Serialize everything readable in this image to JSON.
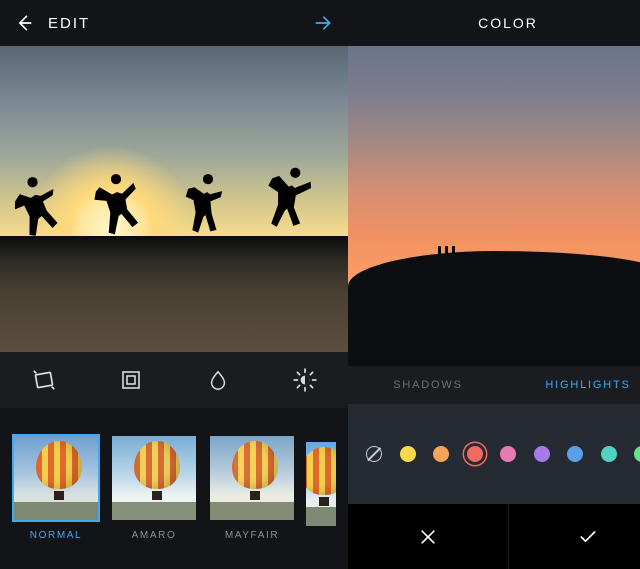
{
  "left": {
    "header_title": "EDIT",
    "tools": [
      {
        "name": "straighten",
        "label": "Straighten"
      },
      {
        "name": "frame",
        "label": "Frame"
      },
      {
        "name": "blur",
        "label": "Tilt Shift"
      },
      {
        "name": "lux",
        "label": "Lux"
      }
    ],
    "filters": [
      {
        "label": "NORMAL",
        "selected": true
      },
      {
        "label": "AMARO",
        "selected": false
      },
      {
        "label": "MAYFAIR",
        "selected": false
      },
      {
        "label": "",
        "selected": false
      }
    ]
  },
  "right": {
    "header_title": "COLOR",
    "tabs": [
      {
        "label": "SHADOWS",
        "active": false
      },
      {
        "label": "HIGHLIGHTS",
        "active": true
      }
    ],
    "swatches": [
      {
        "name": "none",
        "color": "none",
        "selected": false
      },
      {
        "name": "yellow",
        "color": "#f7d94c",
        "selected": false
      },
      {
        "name": "orange",
        "color": "#f4a35a",
        "selected": false
      },
      {
        "name": "red",
        "color": "#ef6a63",
        "selected": true
      },
      {
        "name": "pink",
        "color": "#e77bb4",
        "selected": false
      },
      {
        "name": "purple",
        "color": "#a77be7",
        "selected": false
      },
      {
        "name": "blue",
        "color": "#5aa0e7",
        "selected": false
      },
      {
        "name": "teal",
        "color": "#4fd2c2",
        "selected": false
      },
      {
        "name": "green",
        "color": "#69e389",
        "selected": false
      }
    ],
    "confirm": {
      "cancel_icon": "close",
      "accept_icon": "check"
    }
  },
  "colors": {
    "accent": "#3fa9f5"
  }
}
